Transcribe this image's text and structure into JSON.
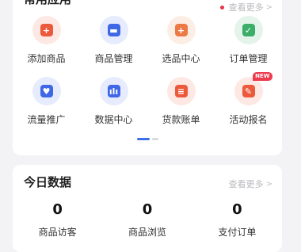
{
  "apps_card": {
    "title": "常用应用",
    "more": "查看更多",
    "indicator_color": "#e8334a",
    "apps": [
      {
        "label": "添加商品",
        "icon": "add-product-icon",
        "glyph": "+",
        "bg": "#fde8e4",
        "fg": "#ec5a3c"
      },
      {
        "label": "商品管理",
        "icon": "shopping-bag-icon",
        "glyph": "▬",
        "bg": "#e6ecfd",
        "fg": "#3f67e6"
      },
      {
        "label": "选品中心",
        "icon": "cart-icon",
        "glyph": "+",
        "bg": "#fdeee5",
        "fg": "#ec7a45"
      },
      {
        "label": "订单管理",
        "icon": "order-check-icon",
        "glyph": "✓",
        "bg": "#e4f4ea",
        "fg": "#3cae6a"
      },
      {
        "label": "流量推广",
        "icon": "traffic-promotion-icon",
        "glyph": "♥",
        "bg": "#e6ecfd",
        "fg": "#3f67e6"
      },
      {
        "label": "数据中心",
        "icon": "bar-chart-icon",
        "glyph": "ılı",
        "bg": "#e6ecfd",
        "fg": "#3f67e6"
      },
      {
        "label": "货款账单",
        "icon": "bill-icon",
        "glyph": "≡",
        "bg": "#fde8e4",
        "fg": "#ec5a3c"
      },
      {
        "label": "活动报名",
        "icon": "activity-signup-icon",
        "glyph": "✎",
        "bg": "#fde8e4",
        "fg": "#ec5a3c",
        "badge": "NEW"
      }
    ],
    "pager_colors": {
      "active": "#3d6fe8",
      "inactive": "#d8dae2"
    }
  },
  "data_card": {
    "title": "今日数据",
    "more": "查看更多",
    "stats": [
      {
        "value": "0",
        "label": "商品访客"
      },
      {
        "value": "0",
        "label": "商品浏览"
      },
      {
        "value": "0",
        "label": "支付订单"
      }
    ]
  }
}
